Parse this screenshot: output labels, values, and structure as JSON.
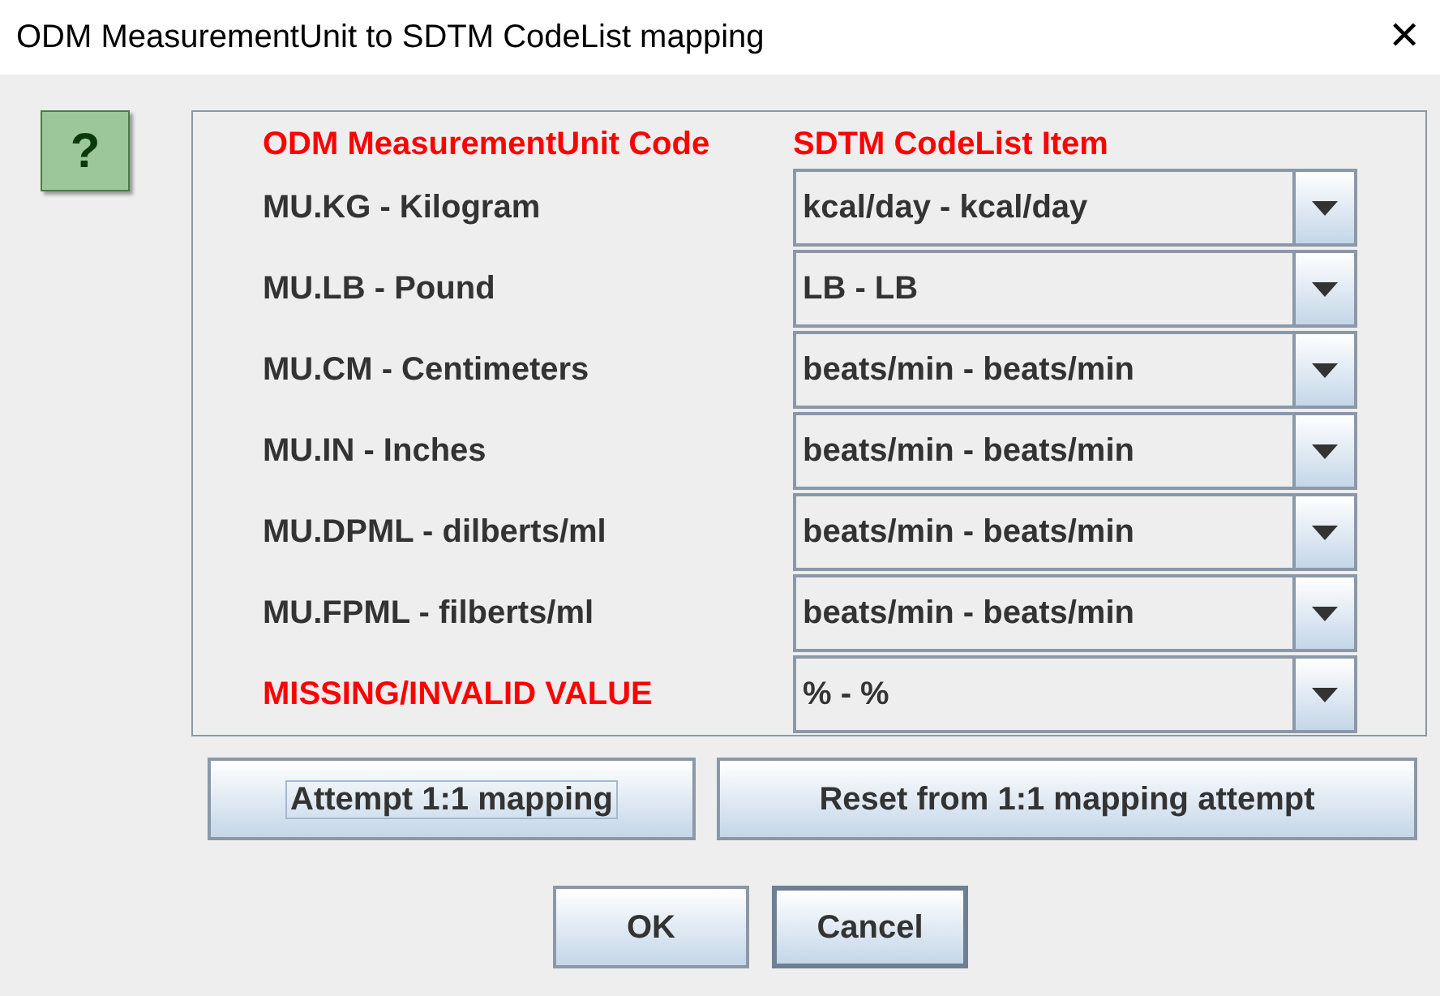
{
  "window": {
    "title": "ODM MeasurementUnit to SDTM CodeList mapping",
    "close": "✕"
  },
  "help": {
    "symbol": "?"
  },
  "table": {
    "columns": [
      "ODM MeasurementUnit Code",
      "SDTM CodeList Item"
    ],
    "rows": [
      {
        "kind": "unit",
        "code": "MU.KG - Kilogram",
        "value": "kcal/day - kcal/day"
      },
      {
        "kind": "unit",
        "code": "MU.LB - Pound",
        "value": "LB - LB"
      },
      {
        "kind": "unit",
        "code": "MU.CM - Centimeters",
        "value": "beats/min - beats/min"
      },
      {
        "kind": "unit",
        "code": "MU.IN - Inches",
        "value": "beats/min - beats/min"
      },
      {
        "kind": "unit",
        "code": "MU.DPML - dilberts/ml",
        "value": "beats/min - beats/min"
      },
      {
        "kind": "unit",
        "code": "MU.FPML - filberts/ml",
        "value": "beats/min - beats/min"
      },
      {
        "kind": "missing",
        "code": "MISSING/INVALID VALUE",
        "value": "% - %"
      }
    ]
  },
  "mapping_buttons": [
    {
      "label": "Attempt 1:1 mapping",
      "focused": true
    },
    {
      "label": "Reset from 1:1 mapping attempt",
      "focused": false
    }
  ],
  "dialog_buttons": [
    {
      "label": "OK",
      "default": false
    },
    {
      "label": "Cancel",
      "default": true
    }
  ]
}
